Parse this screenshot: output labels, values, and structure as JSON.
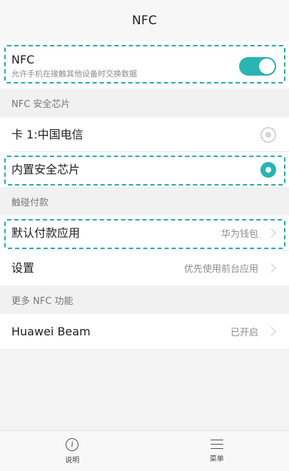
{
  "page": {
    "title": "NFC"
  },
  "nfc": {
    "title": "NFC",
    "subtitle": "允许手机在接触其他设备时交换数据",
    "enabled": true
  },
  "sections": {
    "secure_chip": "NFC 安全芯片",
    "payment": "触碰付款",
    "more": "更多 NFC 功能"
  },
  "secure_chip": {
    "options": [
      {
        "label": "卡 1:中国电信",
        "selected": false
      },
      {
        "label": "内置安全芯片",
        "selected": true
      }
    ]
  },
  "payment": {
    "default_app": {
      "label": "默认付款应用",
      "value": "华为钱包"
    },
    "settings": {
      "label": "设置",
      "value": "优先使用前台应用"
    }
  },
  "more": {
    "huawei_beam": {
      "label": "Huawei Beam",
      "value": "已开启"
    }
  },
  "bottom_nav": {
    "help": "说明",
    "menu": "菜单"
  },
  "colors": {
    "accent": "#2ab5b1",
    "highlight_border": "#2aa9a5",
    "background": "#f3f3f3"
  },
  "icons": {
    "help": "info-icon",
    "menu": "menu-icon"
  }
}
